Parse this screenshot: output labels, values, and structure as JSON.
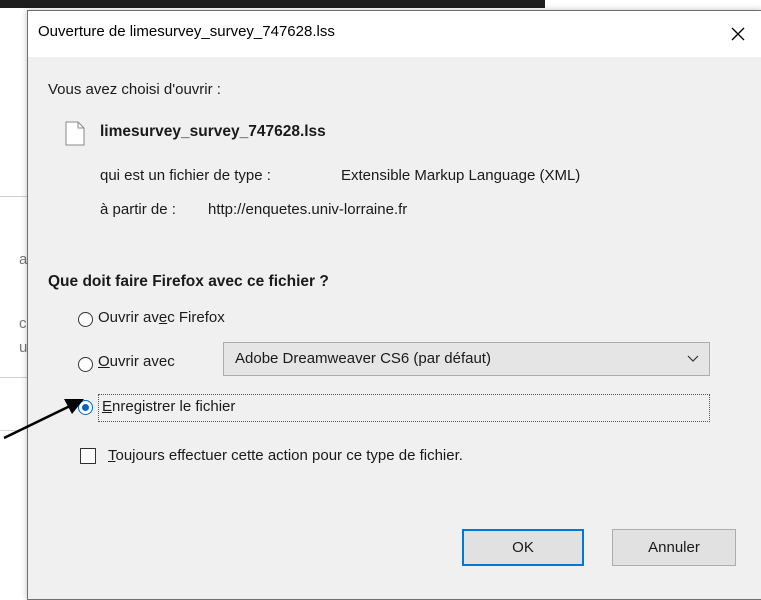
{
  "dialog": {
    "title": "Ouverture de limesurvey_survey_747628.lss",
    "intro": "Vous avez choisi d'ouvrir :",
    "file": {
      "icon": "blank-document-icon",
      "name": "limesurvey_survey_747628.lss",
      "type_label": "qui est un fichier de type :",
      "type_value": "Extensible Markup Language (XML)",
      "source_label": "à partir de :",
      "source_value": "http://enquetes.univ-lorraine.fr"
    },
    "question": "Que doit faire Firefox avec ce fichier ?",
    "options": [
      {
        "prefix": "Ouvrir av",
        "accel": "e",
        "suffix": "c Firefox",
        "selected": false
      },
      {
        "prefix": "",
        "accel": "O",
        "suffix": "uvrir avec",
        "selected": false
      },
      {
        "prefix": "",
        "accel": "E",
        "suffix": "nregistrer le fichier",
        "selected": true
      }
    ],
    "app_select": {
      "value": "Adobe Dreamweaver CS6 (par défaut)"
    },
    "always_checkbox": {
      "accel": "T",
      "suffix": "oujours effectuer cette action pour ce type de fichier.",
      "checked": false
    },
    "buttons": {
      "ok": "OK",
      "cancel": "Annuler"
    }
  },
  "background": {
    "glyphs": [
      "a",
      "c",
      "u"
    ]
  },
  "colors": {
    "accent": "#0067c0",
    "focus_border": "#0078d7",
    "arrow": "#000000"
  }
}
